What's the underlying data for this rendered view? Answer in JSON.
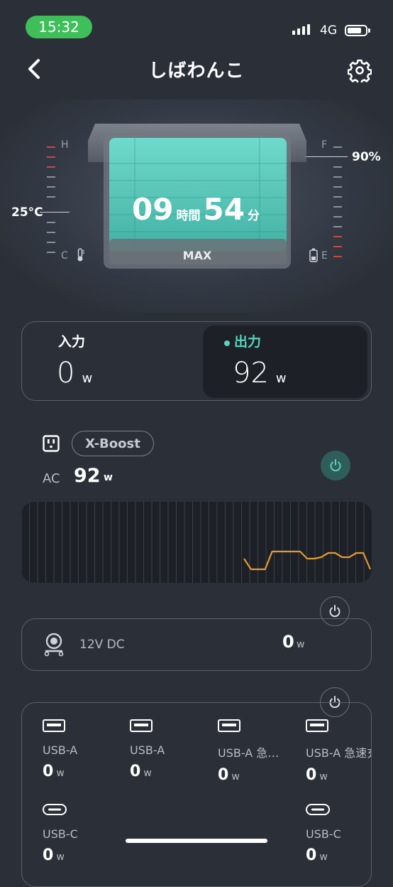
{
  "status_bar": {
    "time": "15:32",
    "network": "4G"
  },
  "header": {
    "title": "しばわんこ"
  },
  "hero": {
    "temperature": "25°C",
    "battery_percent": "90%",
    "gauge_left_top": "H",
    "gauge_left_bottom": "C",
    "gauge_right_top": "F",
    "gauge_right_bottom": "E",
    "hours": "09",
    "hours_unit": "時間",
    "minutes": "54",
    "minutes_unit": "分",
    "mode": "MAX"
  },
  "io": {
    "input_label": "入力",
    "input_value": "0",
    "input_unit": "w",
    "output_label": "出力",
    "output_value": "92",
    "output_unit": "w"
  },
  "ac": {
    "xboost_label": "X-Boost",
    "label": "AC",
    "value": "92",
    "unit": "w",
    "power_on": true
  },
  "chart_data": {
    "type": "line",
    "series": [
      {
        "values": [
          80,
          95,
          95,
          95,
          70,
          70,
          70,
          70,
          70,
          80,
          80,
          78,
          72,
          72,
          78,
          78,
          72,
          72,
          95
        ]
      }
    ],
    "line_color": "#e59a2f",
    "grid": true
  },
  "dc": {
    "label": "12V DC",
    "value": "0",
    "unit": "w"
  },
  "usb": {
    "ports": [
      {
        "label": "USB-A",
        "value": "0",
        "unit": "w",
        "kind": "usb-a"
      },
      {
        "label": "USB-A",
        "value": "0",
        "unit": "w",
        "kind": "usb-a"
      },
      {
        "label": "USB-A 急…",
        "value": "0",
        "unit": "w",
        "kind": "usb-a"
      },
      {
        "label": "USB-A 急速充",
        "value": "0",
        "unit": "w",
        "kind": "usb-a"
      },
      {
        "label": "USB-C",
        "value": "0",
        "unit": "w",
        "kind": "usb-c"
      },
      {
        "label": "USB-C",
        "value": "0",
        "unit": "w",
        "kind": "usb-c"
      }
    ]
  },
  "colors": {
    "accent": "#58d3bf",
    "background": "#2b3038",
    "chart_line": "#e59a2f"
  }
}
